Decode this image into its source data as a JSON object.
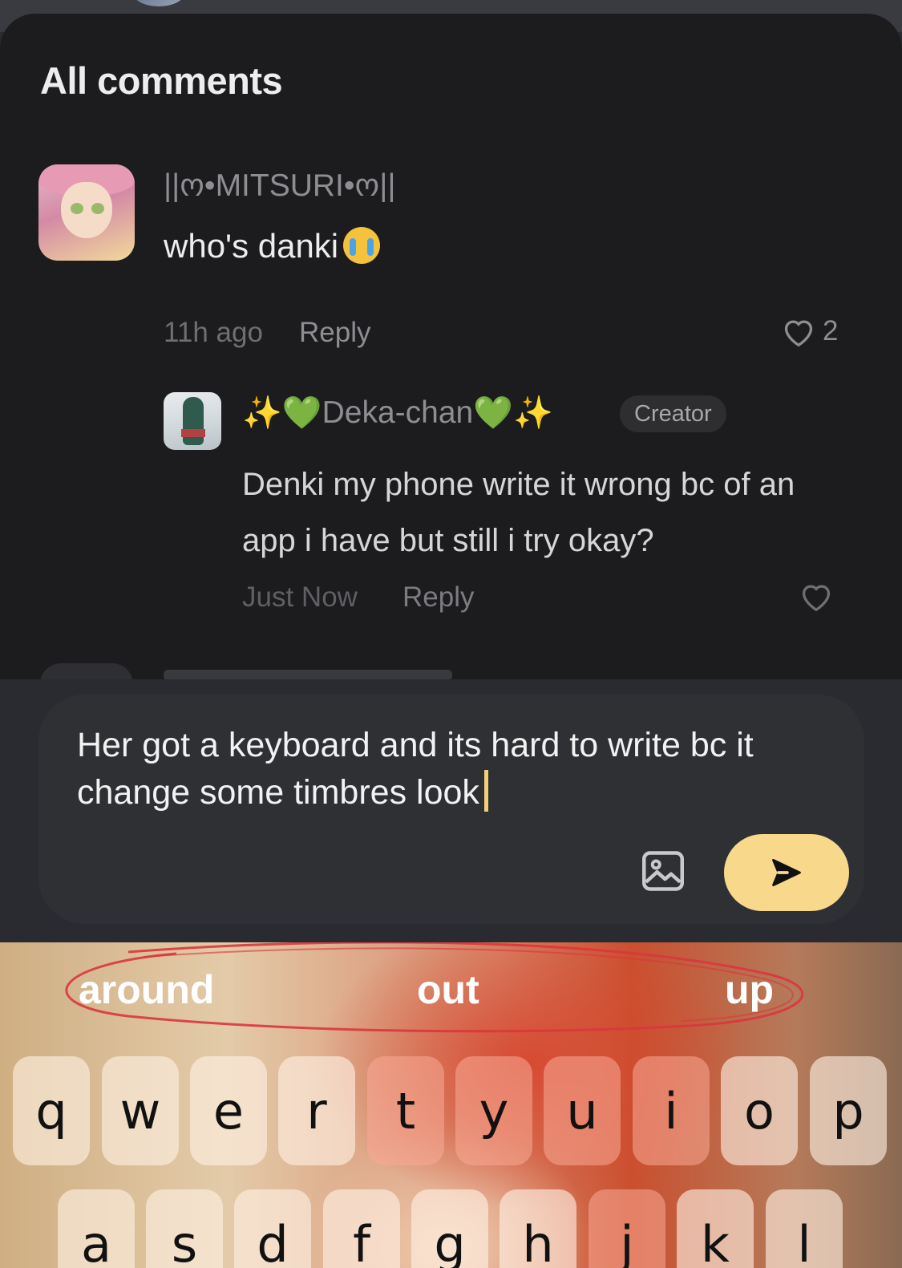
{
  "sheet": {
    "title": "All comments"
  },
  "comment": {
    "username": "||ო•MITSURI•ო||",
    "text": "who's danki",
    "time": "11h ago",
    "reply_label": "Reply",
    "likes": "2"
  },
  "reply": {
    "username": "Deka-chan",
    "badge": "Creator",
    "text": "Denki my phone write it wrong bc of an app i have but still i try okay?",
    "time": "Just Now",
    "reply_label": "Reply"
  },
  "composer": {
    "text": "Her got a keyboard and its hard to write bc it change some timbres look"
  },
  "keyboard": {
    "suggestions": [
      "around",
      "out",
      "up"
    ],
    "row1": [
      "q",
      "w",
      "e",
      "r",
      "t",
      "y",
      "u",
      "i",
      "o",
      "p"
    ],
    "row2": [
      "a",
      "s",
      "d",
      "f",
      "g",
      "h",
      "j",
      "k",
      "l"
    ]
  },
  "colors": {
    "background": "#1c1c1e",
    "accent": "#f8d98c",
    "scribble": "#d9363e"
  }
}
